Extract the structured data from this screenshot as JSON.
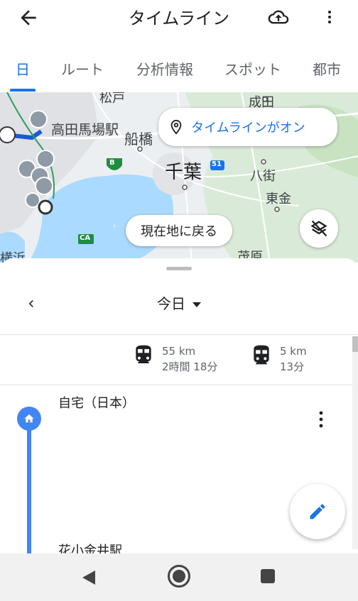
{
  "appbar": {
    "title": "タイムライン",
    "back_icon": "arrow-back-icon",
    "cloud_icon": "cloud-upload-icon",
    "more_icon": "more-vert-icon"
  },
  "tabs": [
    {
      "label": "日",
      "active": true
    },
    {
      "label": "ルート",
      "active": false
    },
    {
      "label": "分析情報",
      "active": false
    },
    {
      "label": "スポット",
      "active": false
    },
    {
      "label": "都市",
      "active": false
    }
  ],
  "map": {
    "timeline_status": "タイムラインがオン",
    "recenter_label": "現在地に戻る",
    "labels": {
      "matsudo": "松戸",
      "takadanobaba": "高田馬場駅",
      "funabashi": "船橋",
      "narita": "成田",
      "chiba": "千葉",
      "yachimata": "八街",
      "togane": "東金",
      "mobara": "茂原",
      "yokohama": "横浜"
    },
    "route_badges": {
      "b": "B",
      "r51": "51",
      "ca": "CA"
    }
  },
  "sheet": {
    "date_label": "今日",
    "stats": [
      {
        "icon": "train-icon",
        "distance": "55 km",
        "duration": "2時間 18分"
      },
      {
        "icon": "subway-icon",
        "distance": "5 km",
        "duration": "13分"
      }
    ],
    "places": [
      {
        "name": "自宅（日本）",
        "icon": "home-icon"
      },
      {
        "name": "花小金井駅"
      }
    ]
  },
  "colors": {
    "accent": "#1a73e8",
    "timeline": "#4285f4",
    "water": "#aadaff"
  }
}
